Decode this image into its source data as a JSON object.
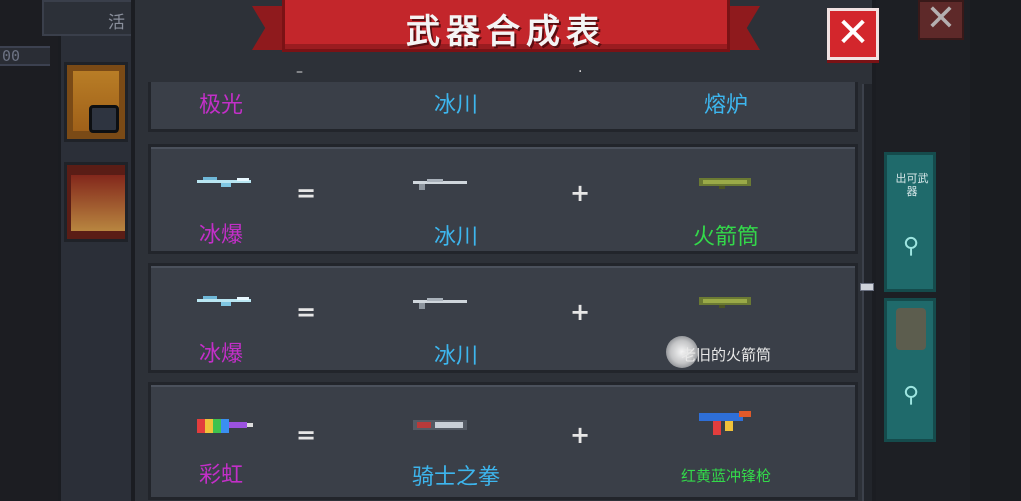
{
  "background": {
    "left_tab_label": "活",
    "left_bar_text": "00",
    "side_button_text": "出可武器",
    "close_label": "✕"
  },
  "header": {
    "title": "武器合成表",
    "close_label": "✕"
  },
  "operators": {
    "equals": "=",
    "plus": "+"
  },
  "recipes": [
    {
      "result": "极光",
      "first": "冰川",
      "second": "熔炉",
      "second_color": "blue",
      "second_small": false,
      "partial": true
    },
    {
      "result": "冰爆",
      "first": "冰川",
      "second": "火箭筒",
      "second_color": "green",
      "second_small": false,
      "partial": false
    },
    {
      "result": "冰爆",
      "first": "冰川",
      "second": "老旧的火箭筒",
      "second_color": "white",
      "second_small": true,
      "partial": false
    },
    {
      "result": "彩虹",
      "first": "骑士之拳",
      "second": "红黄蓝冲锋枪",
      "second_color": "green",
      "second_small": true,
      "partial": false
    }
  ],
  "colors": {
    "result_text": "#c32fc8",
    "ingredient_blue": "#3db6ee",
    "ingredient_green": "#33d94a",
    "banner_red": "#c3262b",
    "close_red": "#d3262c"
  },
  "icons": {
    "result_gun": "ice-rifle-icon",
    "first_gun": "glacier-rifle-icon",
    "second_gun": "rocket-launcher-icon",
    "rainbow_gun": "rainbow-gun-icon",
    "knight_fist": "knight-fist-gun-icon",
    "rgb_smg": "rgb-smg-icon"
  }
}
